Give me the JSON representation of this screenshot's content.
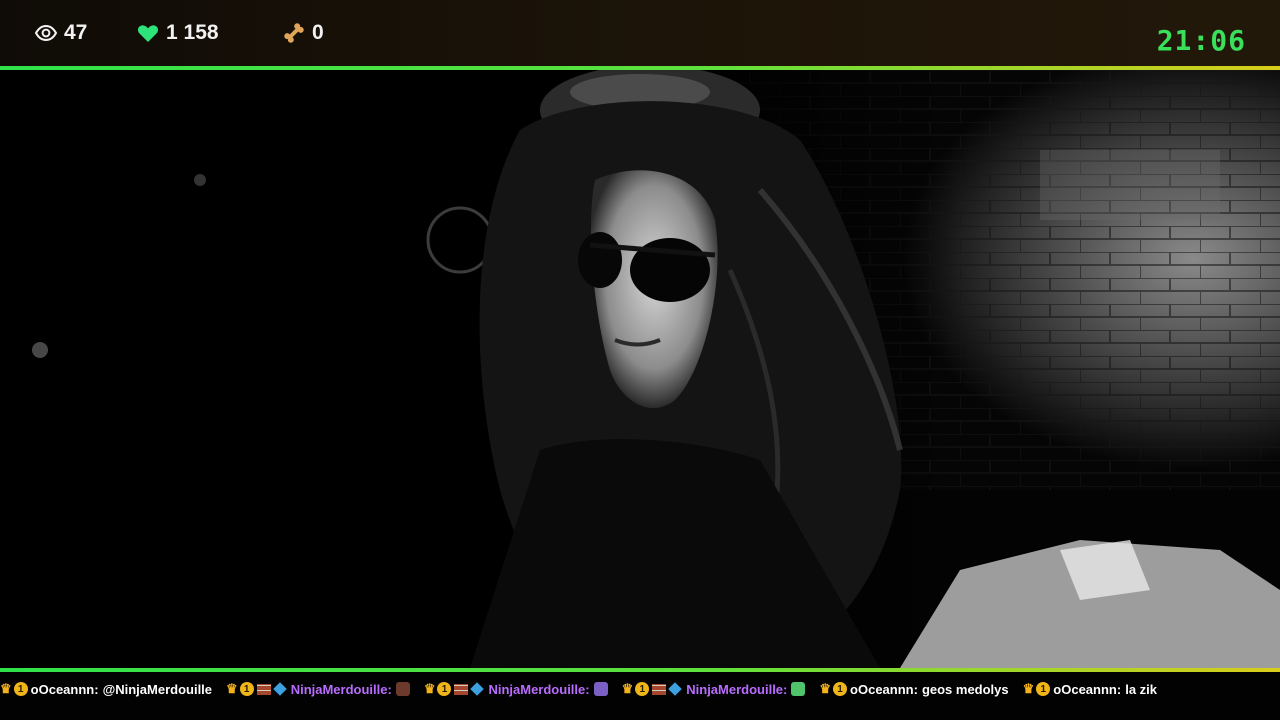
{
  "stats": {
    "viewers": "47",
    "likes": "1 158",
    "bones": "0"
  },
  "clock": "21:06",
  "colors": {
    "accent_green": "#2fe24a",
    "accent_yellow": "#d8cd1a",
    "clock_green": "#39e05a",
    "heart_green": "#2ee37a",
    "username_purple": "#b96cff",
    "crown_gold": "#f3b21c"
  },
  "icons": {
    "viewers": "eye-icon",
    "likes": "heart-icon",
    "bones": "bone-icon"
  },
  "ticker": [
    {
      "user": "oOceannn:",
      "user_style": "white",
      "text": "@NinjaMerdouille",
      "emote": ""
    },
    {
      "user": "NinjaMerdouille:",
      "user_style": "purple",
      "text": "",
      "emote": "#6b3a2c"
    },
    {
      "user": "NinjaMerdouille:",
      "user_style": "purple",
      "text": "",
      "emote": "#7a5fc4"
    },
    {
      "user": "NinjaMerdouille:",
      "user_style": "purple",
      "text": "",
      "emote": "#4fc46a"
    },
    {
      "user": "oOceannn:",
      "user_style": "white",
      "text": "geos medolys",
      "emote": ""
    },
    {
      "user": "oOceannn:",
      "user_style": "white",
      "text": "la zik",
      "emote": ""
    }
  ]
}
